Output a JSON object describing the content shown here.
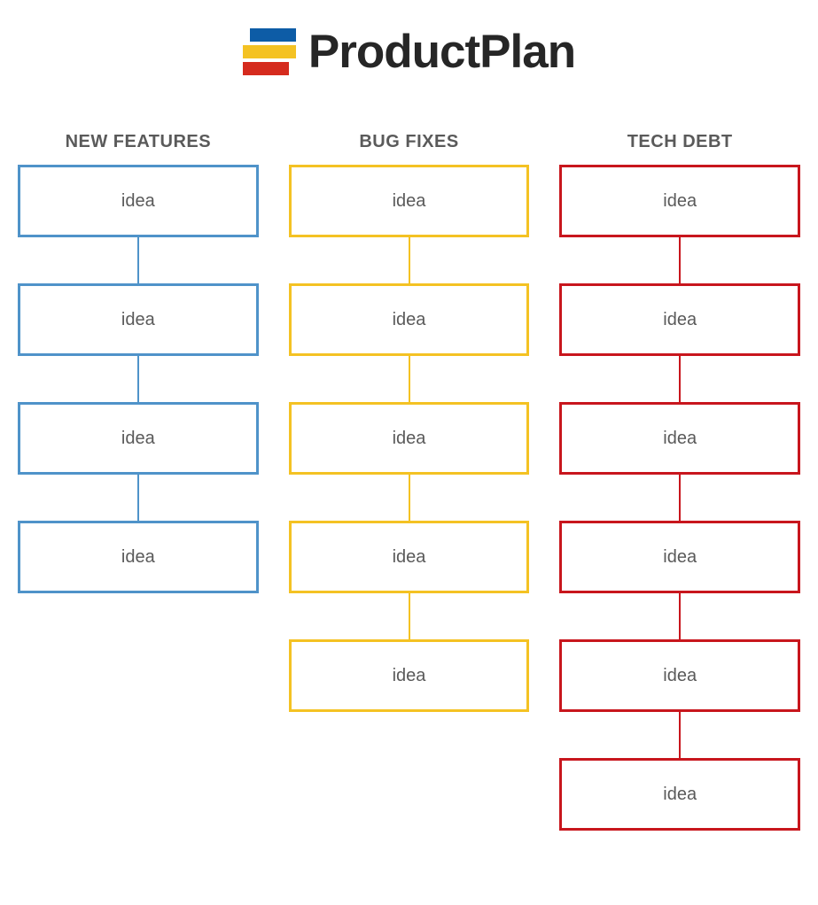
{
  "brand": "ProductPlan",
  "columns": [
    {
      "id": "new-features",
      "title": "NEW FEATURES",
      "colorClass": "col-blue",
      "color": "#4f93c9",
      "items": [
        "idea",
        "idea",
        "idea",
        "idea"
      ]
    },
    {
      "id": "bug-fixes",
      "title": "BUG FIXES",
      "colorClass": "col-yellow",
      "color": "#f4c223",
      "items": [
        "idea",
        "idea",
        "idea",
        "idea",
        "idea"
      ]
    },
    {
      "id": "tech-debt",
      "title": "TECH DEBT",
      "colorClass": "col-red",
      "color": "#c8161d",
      "items": [
        "idea",
        "idea",
        "idea",
        "idea",
        "idea",
        "idea"
      ]
    }
  ]
}
